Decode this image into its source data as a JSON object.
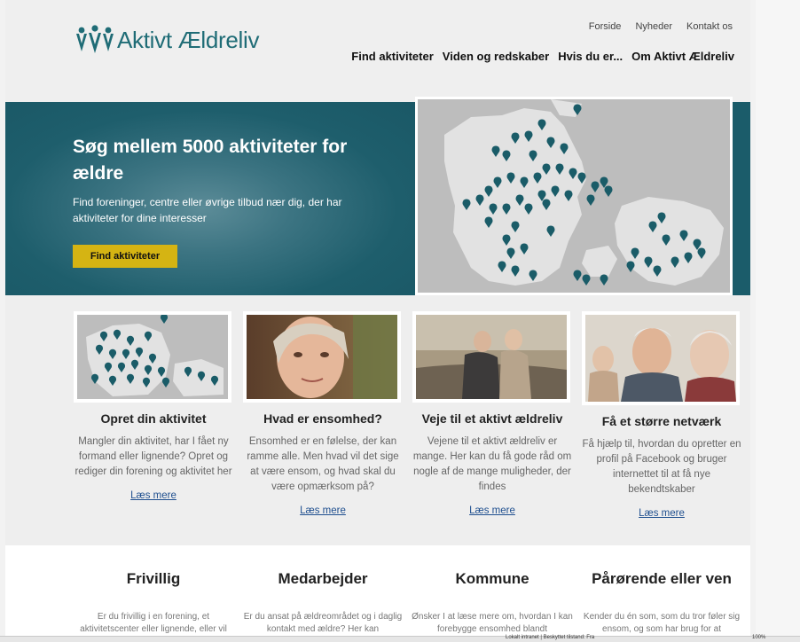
{
  "header": {
    "logo_text": "Aktivt Ældreliv",
    "top_links": [
      "Forside",
      "Nyheder",
      "Kontakt os"
    ],
    "main_nav": [
      "Find aktiviteter",
      "Viden og redskaber",
      "Hvis du er...",
      "Om Aktivt Ældreliv"
    ]
  },
  "hero": {
    "title": "Søg mellem 5000 aktiviteter for ældre",
    "subtitle": "Find foreninger, centre eller øvrige tilbud nær dig, der har aktiviteter for dine interesser",
    "button_label": "Find aktiviteter"
  },
  "cards": [
    {
      "title": "Opret din aktivitet",
      "text": "Mangler din aktivitet, har I fået ny formand eller lignende? Opret og rediger din forening og aktivitet her",
      "link": "Læs mere",
      "image": "map"
    },
    {
      "title": "Hvad er ensomhed?",
      "text": "Ensomhed er en følelse, der kan ramme alle. Men hvad vil det sige at være ensom, og hvad skal du være opmærksom på?",
      "link": "Læs mere",
      "image": "woman-portrait"
    },
    {
      "title": "Veje til et aktivt ældreliv",
      "text": "Vejene til et aktivt ældreliv er mange. Her kan du få gode råd om nogle af de mange muligheder, der findes",
      "link": "Læs mere",
      "image": "couple-walking"
    },
    {
      "title": "Få et større netværk",
      "text": "Få hjælp til, hvordan du opretter en profil på Facebook og bruger internettet til at få nye bekendtskaber",
      "link": "Læs mere",
      "image": "elderly-group"
    }
  ],
  "bottom": [
    {
      "title": "Frivillig",
      "text": "Er du frivillig i en forening, et aktivitetscenter eller lignende, eller vil"
    },
    {
      "title": "Medarbejder",
      "text": "Er du ansat på ældreområdet og i daglig kontakt med ældre? Her kan"
    },
    {
      "title": "Kommune",
      "text": "Ønsker I at læse mere om, hvordan I kan forebygge ensomhed blandt"
    },
    {
      "title": "Pårørende eller ven",
      "text": "Kender du én som, som du tror føler sig ensom, og som har brug for at"
    }
  ],
  "statusbar": {
    "status": "Lokalt intranet | Beskyttet tilstand: Fra",
    "zoom": "100%"
  },
  "colors": {
    "teal": "#1b5c6a",
    "accent": "#d5b413",
    "logo": "#1f6c76"
  }
}
